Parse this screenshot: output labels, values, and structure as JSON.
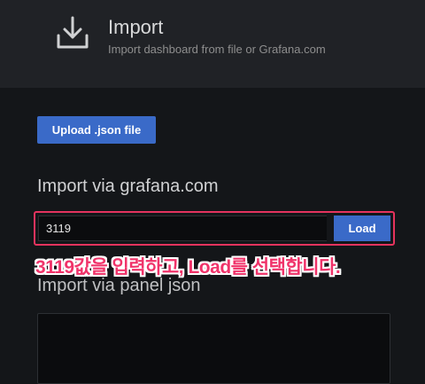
{
  "header": {
    "icon": "download-icon",
    "title": "Import",
    "subtitle": "Import dashboard from file or Grafana.com"
  },
  "upload": {
    "label": "Upload .json file"
  },
  "grafana_import": {
    "title": "Import via grafana.com",
    "input_value": "3119",
    "load_label": "Load"
  },
  "annotation": {
    "text": "3119값을 입력하고, Load를 선택합니다."
  },
  "panel_json": {
    "title": "Import via panel json",
    "value": ""
  },
  "colors": {
    "accent": "#3a6ac8",
    "highlight": "#e5335e",
    "annotation": "#f0336a",
    "background": "#141619",
    "header_background": "#202226"
  }
}
